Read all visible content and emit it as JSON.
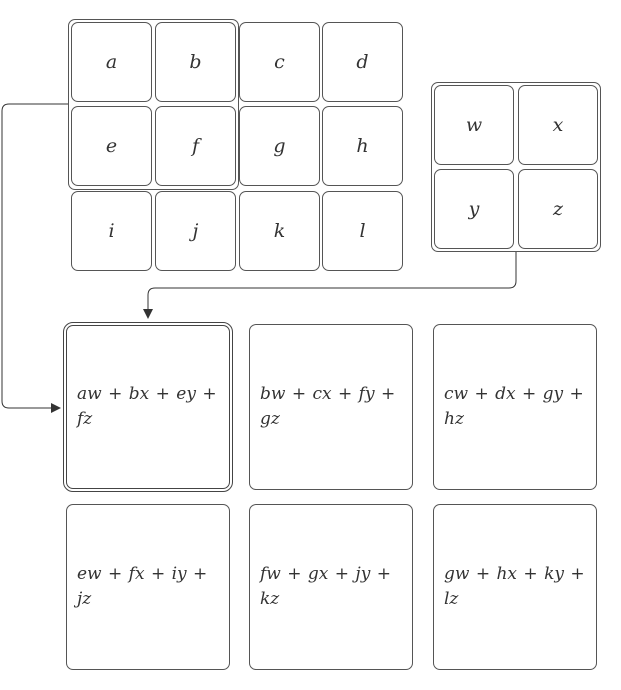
{
  "matrix_a": {
    "cells": [
      "a",
      "b",
      "c",
      "d",
      "e",
      "f",
      "g",
      "h",
      "i",
      "j",
      "k",
      "l"
    ]
  },
  "kernel": {
    "cells": [
      "w",
      "x",
      "y",
      "z"
    ]
  },
  "results": [
    "aw + bx + ey + fz",
    "bw + cx + fy + gz",
    "cw + dx + gy + hz",
    "ew + fx + iy + jz",
    "fw + gx + jy + kz",
    "gw + hx + ky + lz"
  ],
  "colors": {
    "stroke": "#555555",
    "arrow": "#333333",
    "text": "#333333"
  }
}
